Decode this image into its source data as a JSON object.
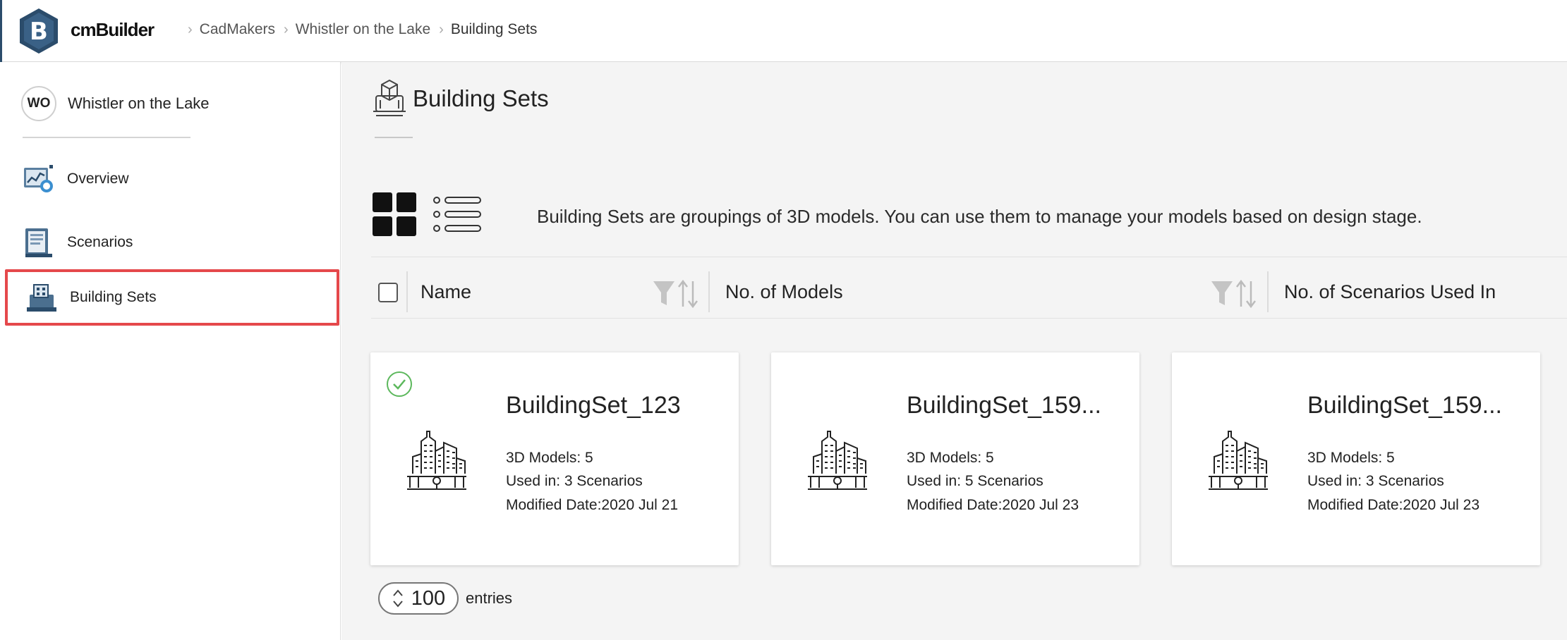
{
  "header": {
    "brand": "cmBuilder",
    "logo_letter": "B",
    "breadcrumbs": [
      "CadMakers",
      "Whistler on the Lake",
      "Building Sets"
    ]
  },
  "sidebar": {
    "project": {
      "initials": "WO",
      "name": "Whistler on the Lake"
    },
    "items": [
      {
        "label": "Overview",
        "icon": "overview-chart-icon"
      },
      {
        "label": "Scenarios",
        "icon": "scenarios-document-icon"
      },
      {
        "label": "Building Sets",
        "icon": "building-sets-icon",
        "active": true
      }
    ]
  },
  "main": {
    "title": "Building Sets",
    "description": "Building Sets are groupings of 3D models. You can use them to manage your models based on design stage.",
    "columns": [
      "Name",
      "No. of Models",
      "No. of Scenarios Used In"
    ],
    "cards": [
      {
        "name": "BuildingSet_123",
        "models": "3D Models: 5",
        "used_in": "Used in: 3 Scenarios",
        "modified": "Modified Date:2020 Jul 21",
        "checked": true
      },
      {
        "name": "BuildingSet_159...",
        "models": "3D Models: 5",
        "used_in": "Used in: 5 Scenarios",
        "modified": "Modified Date:2020 Jul 23",
        "checked": false
      },
      {
        "name": "BuildingSet_159...",
        "models": "3D Models: 5",
        "used_in": "Used in: 3 Scenarios",
        "modified": "Modified Date:2020 Jul 23",
        "checked": false
      }
    ],
    "pagination": {
      "page_size": "100",
      "label": "entries"
    }
  },
  "colors": {
    "active_outline": "#e5484b",
    "logo_blue": "#2b4c6b",
    "check_green": "#5cb85c"
  }
}
